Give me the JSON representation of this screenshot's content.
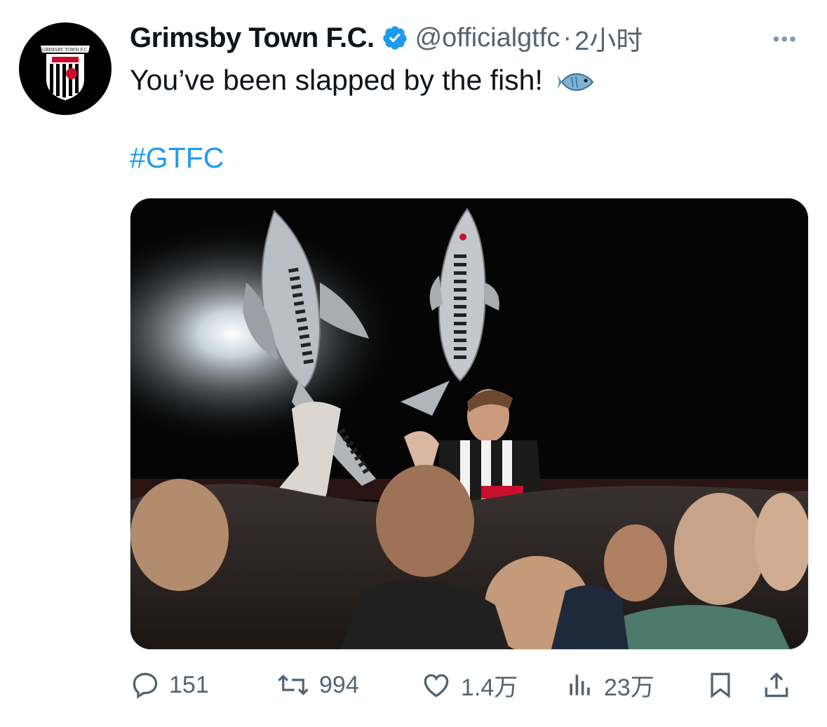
{
  "tweet": {
    "display_name": "Grimsby Town F.C.",
    "handle": "@officialgtfc",
    "separator": "·",
    "time": "2小时",
    "text": "You’ve been slapped by the fish!",
    "hashtag": "#GTFC",
    "more_label": "•••"
  },
  "logo": {
    "banner_text": "GRIMSBY TOWN F.C."
  },
  "actions": {
    "replies": "151",
    "retweets": "994",
    "likes": "1.4万",
    "views": "23万"
  },
  "colors": {
    "link": "#1d9bf0",
    "verified": "#1d9bf0",
    "muted": "#536471"
  },
  "icons": [
    "verified-badge-icon",
    "fish-emoji-icon",
    "more-icon",
    "reply-icon",
    "retweet-icon",
    "like-icon",
    "views-icon",
    "bookmark-icon",
    "share-icon"
  ]
}
